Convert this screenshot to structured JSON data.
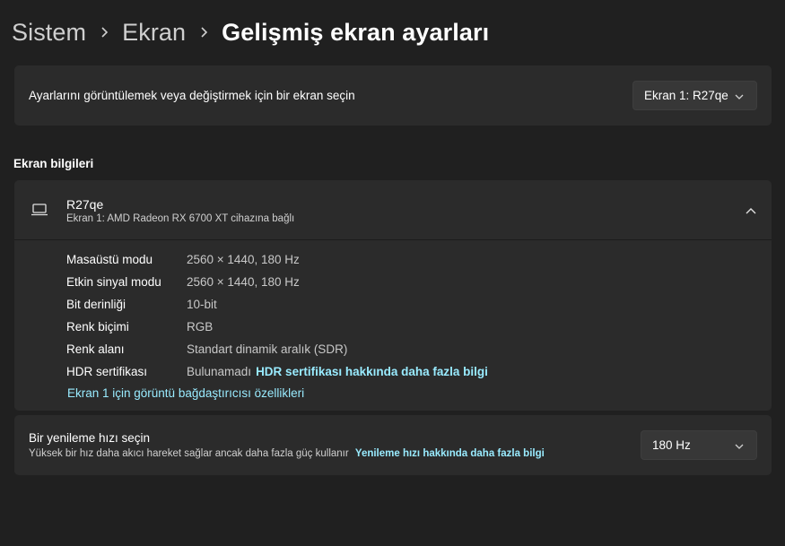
{
  "breadcrumb": {
    "level1": "Sistem",
    "level2": "Ekran",
    "current": "Gelişmiş ekran ayarları"
  },
  "display_select": {
    "label": "Ayarlarını görüntülemek veya değiştirmek için bir ekran seçin",
    "value": "Ekran 1: R27qe"
  },
  "section": {
    "title": "Ekran bilgileri"
  },
  "display_info": {
    "name": "R27qe",
    "subtitle": "Ekran 1: AMD Radeon RX 6700 XT cihazına bağlı",
    "rows": [
      {
        "key": "Masaüstü modu",
        "value": "2560 × 1440, 180 Hz"
      },
      {
        "key": "Etkin sinyal modu",
        "value": "2560 × 1440, 180 Hz"
      },
      {
        "key": "Bit derinliği",
        "value": "10-bit"
      },
      {
        "key": "Renk biçimi",
        "value": "RGB"
      },
      {
        "key": "Renk alanı",
        "value": "Standart dinamik aralık (SDR)"
      },
      {
        "key": "HDR sertifikası",
        "value": "Bulunamadı",
        "link": "HDR sertifikası hakkında daha fazla bilgi"
      }
    ],
    "adapter_link": "Ekran 1 için görüntü bağdaştırıcısı özellikleri"
  },
  "refresh": {
    "title": "Bir yenileme hızı seçin",
    "description": "Yüksek bir hız daha akıcı hareket sağlar ancak daha fazla güç kullanır",
    "link": "Yenileme hızı hakkında daha fazla bilgi",
    "value": "180 Hz"
  },
  "colors": {
    "background": "#202020",
    "card": "#2b2b2b",
    "accent_link": "#99ebff"
  },
  "icons": [
    "chevron-right-icon",
    "chevron-down-icon",
    "chevron-up-icon",
    "laptop-monitor-icon"
  ]
}
